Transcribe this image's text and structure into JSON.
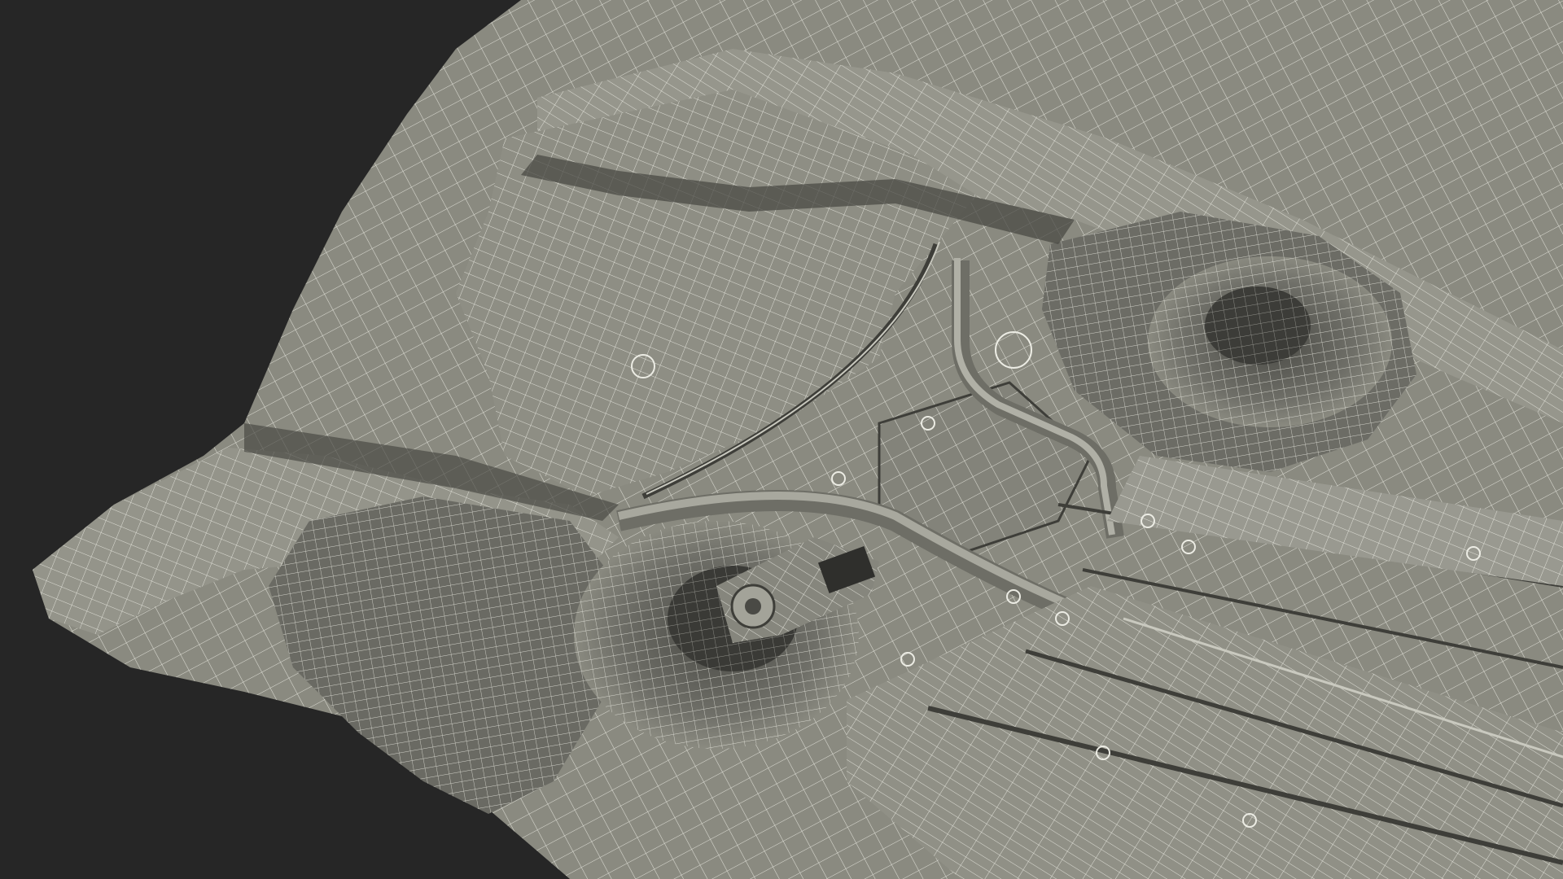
{
  "scene": {
    "subject": "car-underbody-wireframe",
    "background_color": "#262626",
    "surface_color": "#8a8a80",
    "surface_dark": "#5e5e57",
    "surface_light": "#a3a399",
    "wire_color": "#ecece4"
  }
}
